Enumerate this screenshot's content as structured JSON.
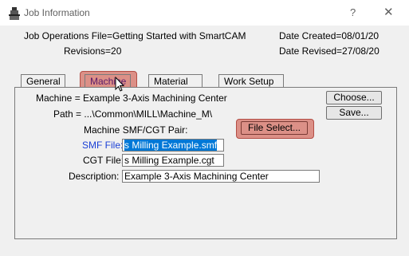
{
  "window": {
    "title": "Job Information",
    "help_label": "?",
    "close_label": "✕",
    "icon": "app-icon"
  },
  "header": {
    "job_ops": "Job Operations File=Getting Started with SmartCAM",
    "revisions": "Revisions=20",
    "date_created": "Date Created=08/01/20",
    "date_revised": "Date Revised=27/08/20"
  },
  "tabs": [
    {
      "label": "General"
    },
    {
      "label": "Machine"
    },
    {
      "label": "Material"
    },
    {
      "label": "Work Setup"
    }
  ],
  "active_tab": "Machine",
  "machine": {
    "machine_text": "Machine = Example 3-Axis Machining Center",
    "path_text": "Path = ...\\Common\\MILL\\Machine_M\\",
    "pair_label": "Machine SMF/CGT Pair:",
    "choose_label": "Choose...",
    "save_label": "Save...",
    "file_select_label": "File Select...",
    "smf_label": "SMF File:",
    "smf_value": "s Milling Example.smf",
    "cgt_label": "CGT File:",
    "cgt_value": "s Milling Example.cgt",
    "description_label": "Description:",
    "description_value": "Example 3-Axis Machining Center"
  },
  "colors": {
    "highlight": "#d67064",
    "selection": "#0078d7",
    "smf_label": "#1a3fd6"
  }
}
